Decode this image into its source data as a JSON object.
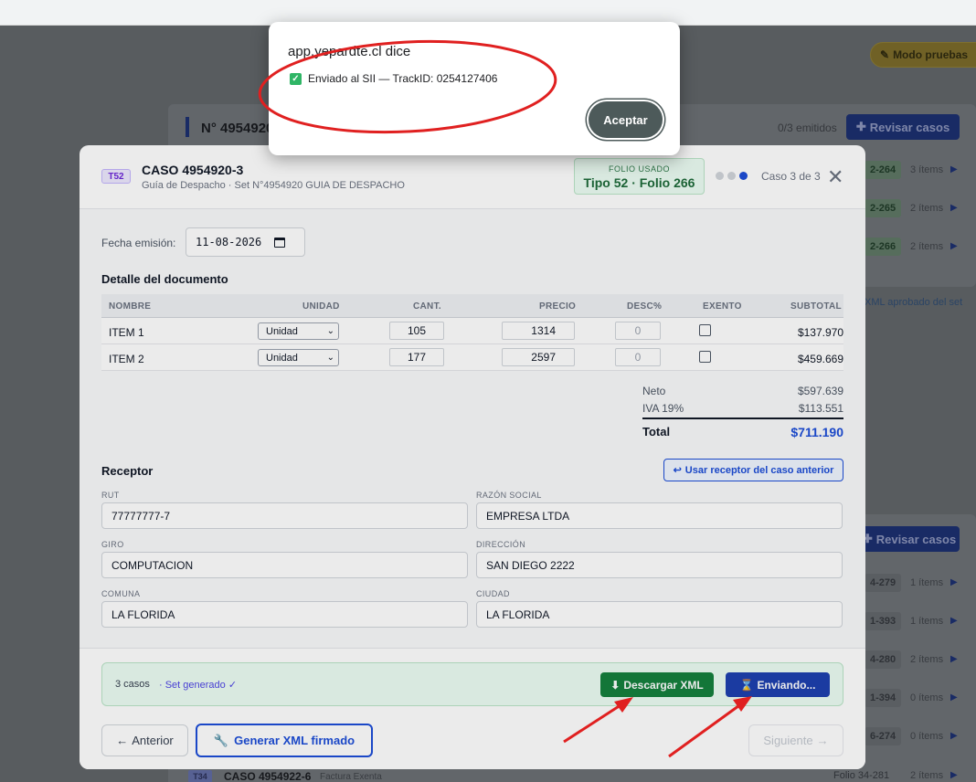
{
  "alert": {
    "title": "app.yepardte.cl dice",
    "message": "Enviado al SII — TrackID: 0254127406",
    "ok_label": "Aceptar"
  },
  "background": {
    "modo_pruebas": "Modo pruebas",
    "set_title": "N° 4954920",
    "emitidos": "0/3 emitidos",
    "revisar_label": "Revisar casos",
    "xml_aprobado": "XML aprobado del set",
    "folios_top": [
      {
        "folio": "2-264",
        "items": "3 ítems"
      },
      {
        "folio": "2-265",
        "items": "2 ítems"
      },
      {
        "folio": "2-266",
        "items": "2 ítems"
      }
    ],
    "folios_bottom": [
      {
        "folio": "4-279",
        "items": "1 ítems"
      },
      {
        "folio": "1-393",
        "items": "1 ítems"
      },
      {
        "folio": "4-280",
        "items": "2 ítems"
      },
      {
        "folio": "1-394",
        "items": "0 ítems"
      },
      {
        "folio": "6-274",
        "items": "0 ítems"
      }
    ],
    "bottom_row": {
      "badge": "T34",
      "title": "CASO 4954922-6",
      "sub": "Factura Exenta",
      "folio": "Folio 34-281",
      "items": "2 ítems"
    }
  },
  "modal": {
    "badge": "T52",
    "title": "CASO 4954920-3",
    "subtitle": "Guía de Despacho · Set N°4954920 GUIA DE DESPACHO",
    "folio_label": "FOLIO USADO",
    "folio_value": "Tipo 52 · Folio 266",
    "step_text": "Caso 3 de 3",
    "fecha_label": "Fecha emisión:",
    "fecha_value": "11-08-2026",
    "detalle_title": "Detalle del documento",
    "columns": [
      "NOMBRE",
      "UNIDAD",
      "CANT.",
      "PRECIO",
      "DESC%",
      "EXENTO",
      "SUBTOTAL"
    ],
    "rows": [
      {
        "nombre": "ITEM 1",
        "unidad": "Unidad",
        "cant": "105",
        "precio": "1314",
        "desc": "0",
        "subtotal": "$137.970"
      },
      {
        "nombre": "ITEM 2",
        "unidad": "Unidad",
        "cant": "177",
        "precio": "2597",
        "desc": "0",
        "subtotal": "$459.669"
      }
    ],
    "totals": {
      "neto_label": "Neto",
      "neto_value": "$597.639",
      "iva_label": "IVA 19%",
      "iva_value": "$113.551",
      "total_label": "Total",
      "total_value": "$711.190"
    },
    "receptor_title": "Receptor",
    "usar_receptor_label": "Usar receptor del caso anterior",
    "fields": {
      "rut_label": "RUT",
      "rut_value": "77777777-7",
      "razon_label": "RAZÓN SOCIAL",
      "razon_value": "EMPRESA LTDA",
      "giro_label": "GIRO",
      "giro_value": "COMPUTACION",
      "direccion_label": "DIRECCIÓN",
      "direccion_value": "SAN DIEGO 2222",
      "comuna_label": "COMUNA",
      "comuna_value": "LA FLORIDA",
      "ciudad_label": "CIUDAD",
      "ciudad_value": "LA FLORIDA"
    },
    "footer": {
      "casos": "3 casos",
      "set_generado": "· Set generado ✓",
      "descargar_label": "Descargar XML",
      "enviando_label": "Enviando...",
      "anterior_label": "Anterior",
      "generar_label": "Generar XML firmado",
      "siguiente_label": "Siguiente"
    }
  },
  "colors": {
    "accent_blue": "#1d4ed8",
    "success_green": "#15803d",
    "annotation_red": "#e02020"
  }
}
